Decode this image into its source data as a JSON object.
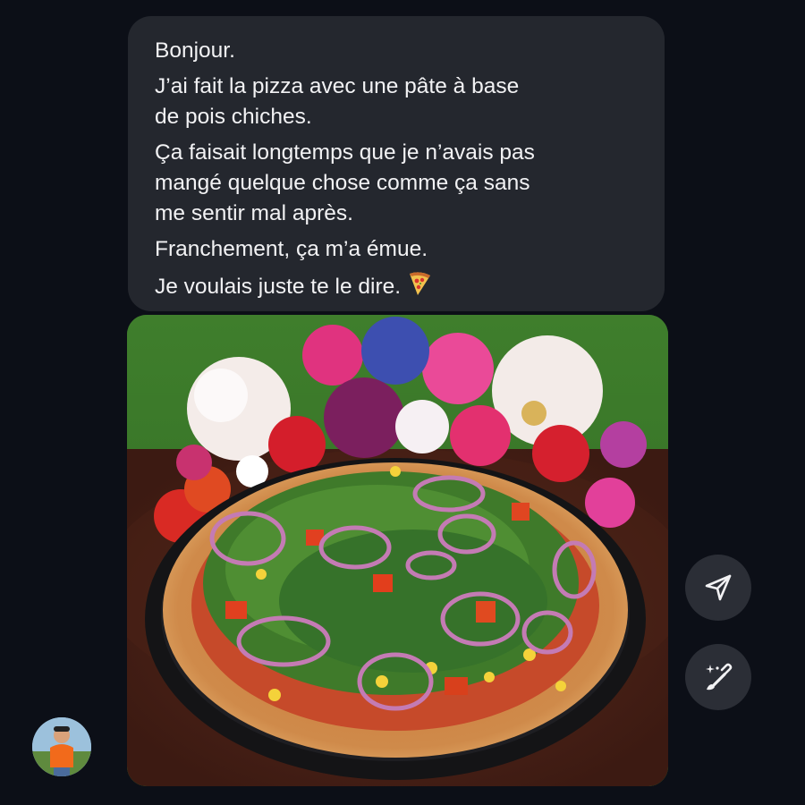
{
  "message": {
    "lines": [
      "Bonjour.",
      "J’ai fait la pizza avec une pâte à base",
      "de pois chiches.",
      "Ça faisait longtemps que je n’avais pas",
      "mangé quelque chose comme ça sans",
      "me sentir mal après.",
      "Franchement, ça m’a émue.",
      "Je voulais juste te le dire."
    ],
    "emoji_icon": "pizza-emoji-icon"
  },
  "actions": {
    "send_icon": "send-icon",
    "edit_icon": "magic-brush-icon"
  },
  "avatar": {
    "icon": "user-avatar"
  },
  "colors": {
    "background": "#0c0f17",
    "bubble": "#24272e",
    "button": "#2b2e36",
    "text": "#f2f2f4"
  }
}
